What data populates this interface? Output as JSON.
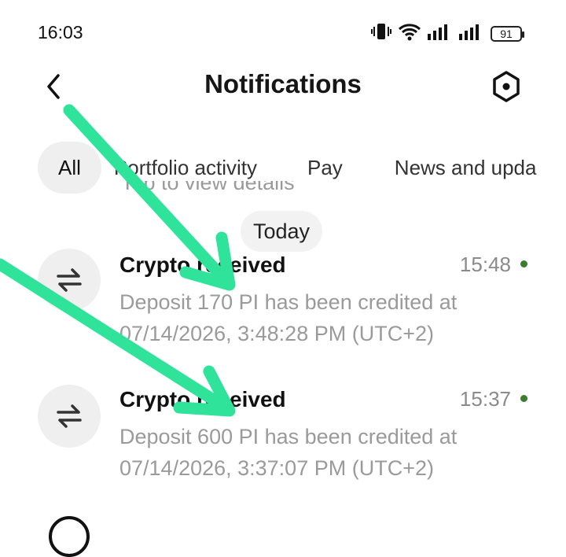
{
  "status_bar": {
    "time": "16:03",
    "battery": "91"
  },
  "header": {
    "title": "Notifications"
  },
  "tabs": [
    {
      "label": "All",
      "active": true
    },
    {
      "label": "Portfolio activity"
    },
    {
      "label": "Pay"
    },
    {
      "label": "News and upda"
    }
  ],
  "cutoff_text": "Tap to view details",
  "section": {
    "label": "Today"
  },
  "notifications": [
    {
      "title": "Crypto received",
      "time": "15:48",
      "description": "Deposit 170 PI has been credited at 07/14/2026, 3:48:28 PM (UTC+2)"
    },
    {
      "title": "Crypto received",
      "time": "15:37",
      "description": "Deposit 600 PI has been credited at 07/14/2026, 3:37:07 PM (UTC+2)"
    }
  ],
  "colors": {
    "arrow": "#2fe39a",
    "unread_dot": "#3a7d2c",
    "pill_bg": "#efefef"
  },
  "icons": [
    "back-icon",
    "settings-icon",
    "transfer-icon",
    "vibrate-icon",
    "wifi-icon",
    "signal-icon",
    "battery-icon"
  ]
}
